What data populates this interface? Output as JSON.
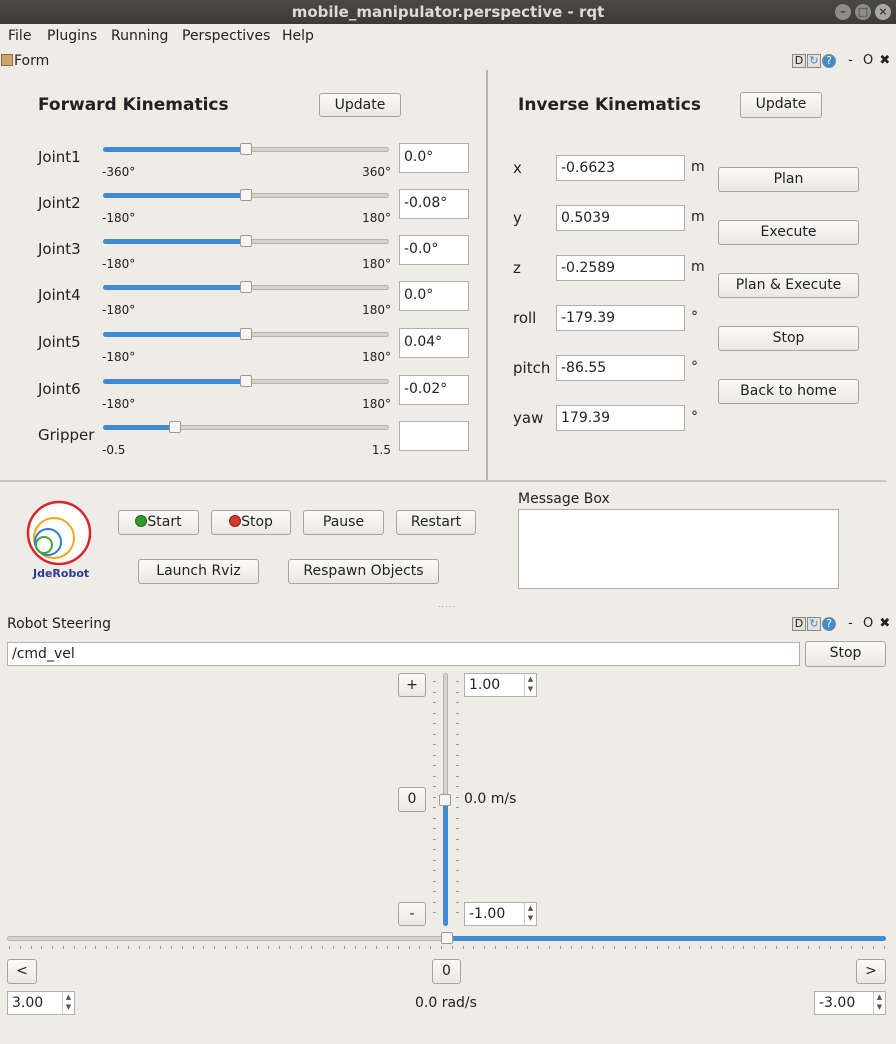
{
  "window": {
    "title": "mobile_manipulator.perspective - rqt"
  },
  "menu": [
    "File",
    "Plugins",
    "Running",
    "Perspectives",
    "Help"
  ],
  "form_dock": {
    "title": "Form",
    "buttons": [
      "D",
      "-",
      "O",
      "✖"
    ]
  },
  "fk": {
    "title": "Forward Kinematics",
    "update_label": "Update",
    "joints": [
      {
        "name": "Joint1",
        "min": "-360°",
        "max": "360°",
        "value": "0.0°",
        "level": 0.5
      },
      {
        "name": "Joint2",
        "min": "-180°",
        "max": "180°",
        "value": "-0.08°",
        "level": 0.5
      },
      {
        "name": "Joint3",
        "min": "-180°",
        "max": "180°",
        "value": "-0.0°",
        "level": 0.5
      },
      {
        "name": "Joint4",
        "min": "-180°",
        "max": "180°",
        "value": "0.0°",
        "level": 0.5
      },
      {
        "name": "Joint5",
        "min": "-180°",
        "max": "180°",
        "value": "0.04°",
        "level": 0.5
      },
      {
        "name": "Joint6",
        "min": "-180°",
        "max": "180°",
        "value": "-0.02°",
        "level": 0.5
      },
      {
        "name": "Gripper",
        "min": "-0.5",
        "max": "1.5",
        "value": "",
        "level": 0.25
      }
    ]
  },
  "ik": {
    "title": "Inverse Kinematics",
    "update_label": "Update",
    "fields": [
      {
        "name": "x",
        "value": "-0.6623",
        "unit": "m"
      },
      {
        "name": "y",
        "value": "0.5039",
        "unit": "m"
      },
      {
        "name": "z",
        "value": "-0.2589",
        "unit": "m"
      },
      {
        "name": "roll",
        "value": "-179.39",
        "unit": "°"
      },
      {
        "name": "pitch",
        "value": "-86.55",
        "unit": "°"
      },
      {
        "name": "yaw",
        "value": "179.39",
        "unit": "°"
      }
    ],
    "actions": [
      "Plan",
      "Execute",
      "Plan & Execute",
      "Stop",
      "Back to home"
    ]
  },
  "control": {
    "logo_text": "JdeRobot",
    "start_label": "Start",
    "stop_label": "Stop",
    "pause_label": "Pause",
    "restart_label": "Restart",
    "launch_rviz_label": "Launch Rviz",
    "respawn_label": "Respawn Objects",
    "message_box_label": "Message Box"
  },
  "steering": {
    "title": "Robot Steering",
    "topic": "/cmd_vel",
    "stop_label": "Stop",
    "plus_label": "+",
    "zero_label": "0",
    "minus_label": "-",
    "max_linear": "1.00",
    "min_linear": "-1.00",
    "linear_readout": "0.0 m/s",
    "linear_level": 0.5,
    "left_label": "<",
    "right_label": ">",
    "center_label": "0",
    "max_angular": "3.00",
    "min_angular": "-3.00",
    "angular_readout": "0.0 rad/s",
    "angular_level": 0.5
  },
  "colors": {
    "accent": "#3f8cd1",
    "titlebar": "#3c3b37"
  }
}
